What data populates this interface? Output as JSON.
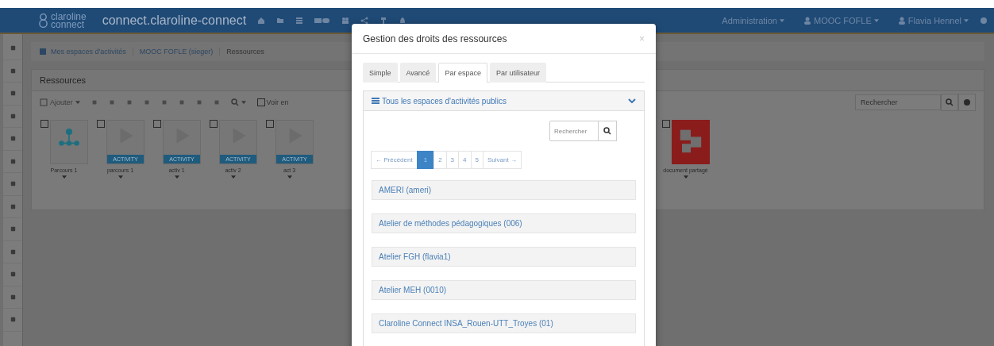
{
  "navbar": {
    "brand_top": "claroline",
    "brand_bottom": "connect",
    "site": "connect.claroline-connect",
    "menus": [
      {
        "label": "Administration",
        "icon": false
      },
      {
        "label": "MOOC FOFLE",
        "icon": true
      },
      {
        "label": "Flavia Hennel",
        "icon": true
      }
    ]
  },
  "breadcrumb": [
    "Mes espaces d'activités",
    "MOOC FOFLE (sieger)",
    "Ressources"
  ],
  "resources": {
    "title": "Ressources",
    "add": "Ajouter",
    "view_toggle": {
      "label": "Voir en",
      "checked": false
    },
    "search_placeholder": "Rechercher",
    "items": [
      {
        "kind": "path",
        "label": "Parcours 1",
        "checked": false
      },
      {
        "kind": "activity",
        "label": "parcours 1",
        "badge": "ACTIVITY",
        "checked": false
      },
      {
        "kind": "activity",
        "label": "activ 1",
        "badge": "ACTIVITY",
        "checked": false
      },
      {
        "kind": "activity",
        "label": "activ 2",
        "badge": "ACTIVITY",
        "checked": false
      },
      {
        "kind": "activity",
        "label": "act 3",
        "badge": "ACTIVITY",
        "checked": false
      }
    ],
    "right_items": [
      {
        "kind": "document",
        "label": "document partagé",
        "checked": false
      }
    ]
  },
  "modal": {
    "title": "Gestion des droits des ressources",
    "close": "×",
    "tabs": [
      {
        "label": "Simple",
        "selected": false
      },
      {
        "label": "Avancé",
        "selected": false
      },
      {
        "label": "Par espace",
        "selected": true
      },
      {
        "label": "Par utilisateur",
        "selected": false
      }
    ],
    "panel_title": "Tous les espaces d'activités publics",
    "search_placeholder": "Rechercher",
    "pagination": [
      {
        "label": "← Précédent",
        "selected": false
      },
      {
        "label": "1",
        "selected": true
      },
      {
        "label": "2",
        "selected": false
      },
      {
        "label": "3",
        "selected": false
      },
      {
        "label": "4",
        "selected": false
      },
      {
        "label": "5",
        "selected": false
      },
      {
        "label": "Suivant →",
        "selected": false
      }
    ],
    "workspaces": [
      "AMERI (ameri)",
      "Atelier de méthodes pédagogiques (006)",
      "Atelier FGH (flavia1)",
      "Atelier MEH (0010)",
      "Claroline Connect INSA_Rouen-UTT_Troyes (01)"
    ]
  }
}
